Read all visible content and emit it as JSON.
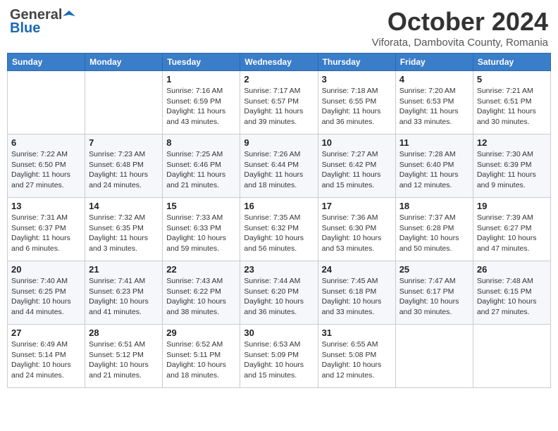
{
  "header": {
    "logo_general": "General",
    "logo_blue": "Blue",
    "month_title": "October 2024",
    "subtitle": "Viforata, Dambovita County, Romania"
  },
  "weekdays": [
    "Sunday",
    "Monday",
    "Tuesday",
    "Wednesday",
    "Thursday",
    "Friday",
    "Saturday"
  ],
  "weeks": [
    [
      {
        "day": "",
        "info": ""
      },
      {
        "day": "",
        "info": ""
      },
      {
        "day": "1",
        "info": "Sunrise: 7:16 AM\nSunset: 6:59 PM\nDaylight: 11 hours and 43 minutes."
      },
      {
        "day": "2",
        "info": "Sunrise: 7:17 AM\nSunset: 6:57 PM\nDaylight: 11 hours and 39 minutes."
      },
      {
        "day": "3",
        "info": "Sunrise: 7:18 AM\nSunset: 6:55 PM\nDaylight: 11 hours and 36 minutes."
      },
      {
        "day": "4",
        "info": "Sunrise: 7:20 AM\nSunset: 6:53 PM\nDaylight: 11 hours and 33 minutes."
      },
      {
        "day": "5",
        "info": "Sunrise: 7:21 AM\nSunset: 6:51 PM\nDaylight: 11 hours and 30 minutes."
      }
    ],
    [
      {
        "day": "6",
        "info": "Sunrise: 7:22 AM\nSunset: 6:50 PM\nDaylight: 11 hours and 27 minutes."
      },
      {
        "day": "7",
        "info": "Sunrise: 7:23 AM\nSunset: 6:48 PM\nDaylight: 11 hours and 24 minutes."
      },
      {
        "day": "8",
        "info": "Sunrise: 7:25 AM\nSunset: 6:46 PM\nDaylight: 11 hours and 21 minutes."
      },
      {
        "day": "9",
        "info": "Sunrise: 7:26 AM\nSunset: 6:44 PM\nDaylight: 11 hours and 18 minutes."
      },
      {
        "day": "10",
        "info": "Sunrise: 7:27 AM\nSunset: 6:42 PM\nDaylight: 11 hours and 15 minutes."
      },
      {
        "day": "11",
        "info": "Sunrise: 7:28 AM\nSunset: 6:40 PM\nDaylight: 11 hours and 12 minutes."
      },
      {
        "day": "12",
        "info": "Sunrise: 7:30 AM\nSunset: 6:39 PM\nDaylight: 11 hours and 9 minutes."
      }
    ],
    [
      {
        "day": "13",
        "info": "Sunrise: 7:31 AM\nSunset: 6:37 PM\nDaylight: 11 hours and 6 minutes."
      },
      {
        "day": "14",
        "info": "Sunrise: 7:32 AM\nSunset: 6:35 PM\nDaylight: 11 hours and 3 minutes."
      },
      {
        "day": "15",
        "info": "Sunrise: 7:33 AM\nSunset: 6:33 PM\nDaylight: 10 hours and 59 minutes."
      },
      {
        "day": "16",
        "info": "Sunrise: 7:35 AM\nSunset: 6:32 PM\nDaylight: 10 hours and 56 minutes."
      },
      {
        "day": "17",
        "info": "Sunrise: 7:36 AM\nSunset: 6:30 PM\nDaylight: 10 hours and 53 minutes."
      },
      {
        "day": "18",
        "info": "Sunrise: 7:37 AM\nSunset: 6:28 PM\nDaylight: 10 hours and 50 minutes."
      },
      {
        "day": "19",
        "info": "Sunrise: 7:39 AM\nSunset: 6:27 PM\nDaylight: 10 hours and 47 minutes."
      }
    ],
    [
      {
        "day": "20",
        "info": "Sunrise: 7:40 AM\nSunset: 6:25 PM\nDaylight: 10 hours and 44 minutes."
      },
      {
        "day": "21",
        "info": "Sunrise: 7:41 AM\nSunset: 6:23 PM\nDaylight: 10 hours and 41 minutes."
      },
      {
        "day": "22",
        "info": "Sunrise: 7:43 AM\nSunset: 6:22 PM\nDaylight: 10 hours and 38 minutes."
      },
      {
        "day": "23",
        "info": "Sunrise: 7:44 AM\nSunset: 6:20 PM\nDaylight: 10 hours and 36 minutes."
      },
      {
        "day": "24",
        "info": "Sunrise: 7:45 AM\nSunset: 6:18 PM\nDaylight: 10 hours and 33 minutes."
      },
      {
        "day": "25",
        "info": "Sunrise: 7:47 AM\nSunset: 6:17 PM\nDaylight: 10 hours and 30 minutes."
      },
      {
        "day": "26",
        "info": "Sunrise: 7:48 AM\nSunset: 6:15 PM\nDaylight: 10 hours and 27 minutes."
      }
    ],
    [
      {
        "day": "27",
        "info": "Sunrise: 6:49 AM\nSunset: 5:14 PM\nDaylight: 10 hours and 24 minutes."
      },
      {
        "day": "28",
        "info": "Sunrise: 6:51 AM\nSunset: 5:12 PM\nDaylight: 10 hours and 21 minutes."
      },
      {
        "day": "29",
        "info": "Sunrise: 6:52 AM\nSunset: 5:11 PM\nDaylight: 10 hours and 18 minutes."
      },
      {
        "day": "30",
        "info": "Sunrise: 6:53 AM\nSunset: 5:09 PM\nDaylight: 10 hours and 15 minutes."
      },
      {
        "day": "31",
        "info": "Sunrise: 6:55 AM\nSunset: 5:08 PM\nDaylight: 10 hours and 12 minutes."
      },
      {
        "day": "",
        "info": ""
      },
      {
        "day": "",
        "info": ""
      }
    ]
  ]
}
